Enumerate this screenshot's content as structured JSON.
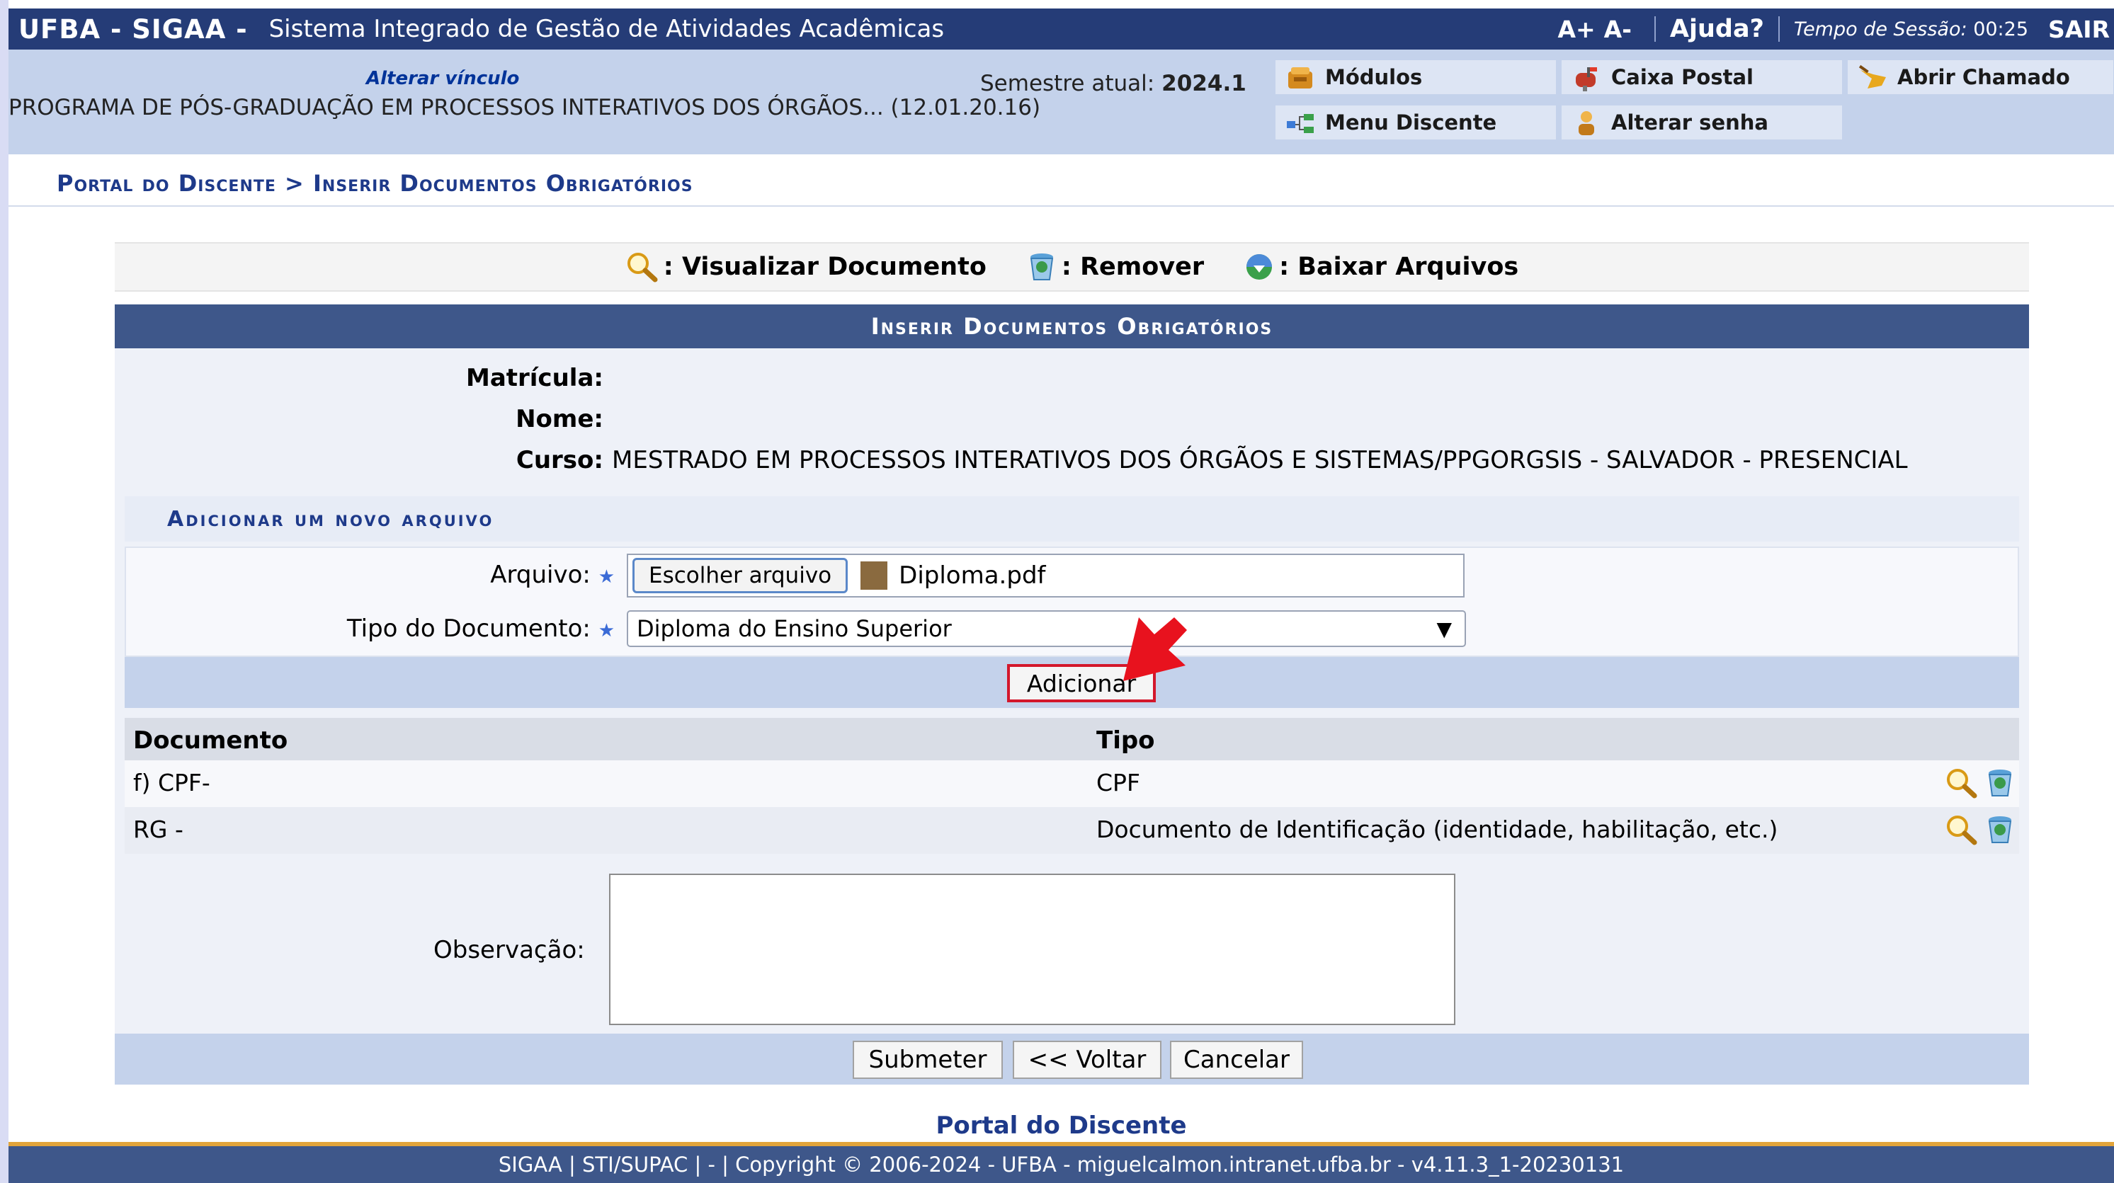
{
  "header": {
    "brand": "UFBA - SIGAA -",
    "system_name": "Sistema Integrado de Gestão de Atividades Acadêmicas",
    "font_increase": "A+",
    "font_decrease": "A-",
    "help": "Ajuda?",
    "session_label": "Tempo de Sessão:",
    "session_time": "00:25",
    "logout": "SAIR"
  },
  "info": {
    "alterar_vinculo": "Alterar vínculo",
    "programa": "PROGRAMA DE PÓS-GRADUAÇÃO EM PROCESSOS INTERATIVOS DOS ÓRGÃOS... (12.01.20.16)",
    "semestre_label": "Semestre atual:",
    "semestre_value": "2024.1"
  },
  "menu": {
    "modulos": "Módulos",
    "caixa_postal": "Caixa Postal",
    "abrir_chamado": "Abrir Chamado",
    "menu_discente": "Menu Discente",
    "alterar_senha": "Alterar senha"
  },
  "breadcrumb": "Portal do Discente > Inserir Documentos Obrigatórios",
  "legend": {
    "visualizar": ": Visualizar Documento",
    "remover": ": Remover",
    "baixar": ": Baixar Arquivos"
  },
  "form": {
    "title": "Inserir Documentos Obrigatórios",
    "matricula_label": "Matrícula:",
    "matricula_value": "",
    "nome_label": "Nome:",
    "nome_value": "",
    "curso_label": "Curso:",
    "curso_value": "MESTRADO EM PROCESSOS INTERATIVOS DOS ÓRGÃOS E SISTEMAS/PPGORGSIS - SALVADOR - PRESENCIAL",
    "add_section": "Adicionar um novo arquivo",
    "arquivo_label": "Arquivo:",
    "choose_file": "Escolher arquivo",
    "file_name": "Diploma.pdf",
    "tipo_label": "Tipo do Documento:",
    "tipo_selected": "Diploma do Ensino Superior",
    "add_button": "Adicionar",
    "table_headers": [
      "Documento",
      "Tipo"
    ],
    "rows": [
      {
        "documento": "f) CPF-",
        "tipo": "CPF"
      },
      {
        "documento": "RG -",
        "tipo": "Documento de Identificação (identidade, habilitação, etc.)"
      }
    ],
    "observacao_label": "Observação:",
    "observacao_value": "",
    "submit": "Submeter",
    "back": "<< Voltar",
    "cancel": "Cancelar"
  },
  "footer": {
    "portal_link": "Portal do Discente",
    "copyright": "SIGAA | STI/SUPAC | - | Copyright © 2006-2024 - UFBA - miguelcalmon.intranet.ufba.br - v4.11.3_1-20230131"
  },
  "colors": {
    "header_bg": "#253c77",
    "band_bg": "#c4d2eb",
    "box_head": "#3e578a",
    "highlight": "#d3172c"
  }
}
